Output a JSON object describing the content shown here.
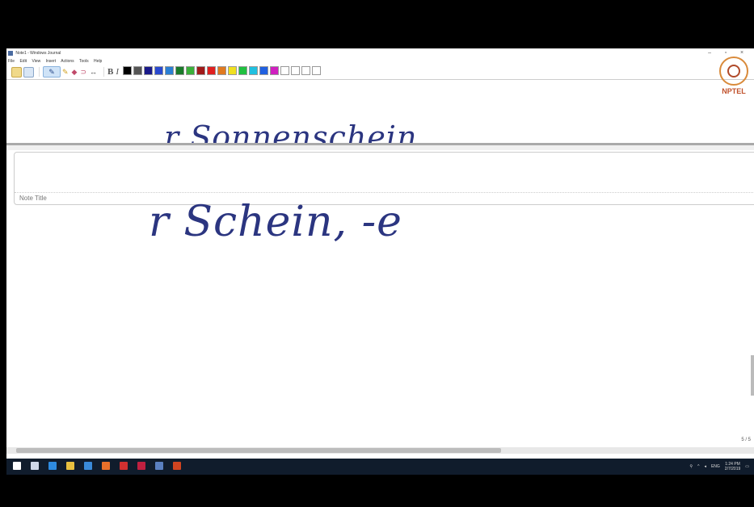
{
  "window": {
    "title": "Note1 - Windows Journal",
    "controls": {
      "minimize": "–",
      "maximize": "▫",
      "close": "×"
    }
  },
  "menu": [
    "File",
    "Edit",
    "View",
    "Insert",
    "Actions",
    "Tools",
    "Help"
  ],
  "toolbar": {
    "bold": "B",
    "italic": "I",
    "palette": [
      "#000000",
      "#555555",
      "#1a1a8a",
      "#2a4ad0",
      "#2b7fd4",
      "#1a7a2a",
      "#3ab03a",
      "#a01a1a",
      "#e02020",
      "#e07a20",
      "#f0e020",
      "#20c040",
      "#20c0e0",
      "#2060e0",
      "#d020c0",
      "#ffffff",
      "#ffffff",
      "#ffffff",
      "#ffffff"
    ]
  },
  "logo": {
    "label": "NPTEL"
  },
  "note": {
    "handwriting_top": "r Sonnenschein",
    "title_label": "Note Title",
    "handwriting_main": "r Schein, -e"
  },
  "status": {
    "page_indicator": "5 / 5"
  },
  "taskbar": {
    "icons": [
      {
        "name": "start-icon",
        "color": "#ffffff"
      },
      {
        "name": "task-view-icon",
        "color": "#cfd8e8"
      },
      {
        "name": "edge-icon",
        "color": "#2e8be0"
      },
      {
        "name": "file-explorer-icon",
        "color": "#e8c040"
      },
      {
        "name": "media-icon",
        "color": "#3a8ad8"
      },
      {
        "name": "firefox-icon",
        "color": "#e8702a"
      },
      {
        "name": "app-red-icon",
        "color": "#d03030"
      },
      {
        "name": "onenote-icon",
        "color": "#c02040"
      },
      {
        "name": "journal-icon",
        "color": "#5a80c0"
      },
      {
        "name": "powerpoint-icon",
        "color": "#d04420"
      }
    ],
    "language": "ENG",
    "time": "1:24 PM",
    "date": "2/7/2019"
  }
}
